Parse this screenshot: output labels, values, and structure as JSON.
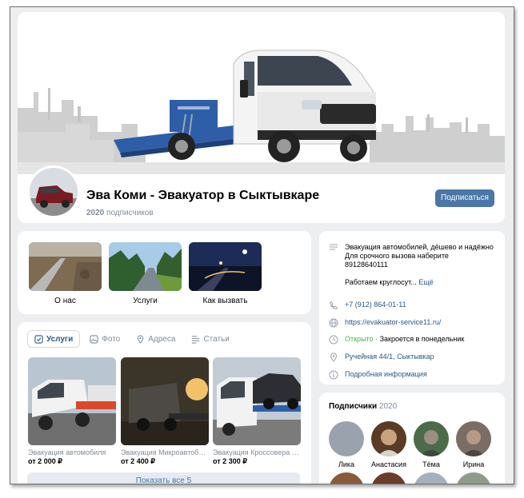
{
  "community": {
    "title": "Эва Коми - Эвакуатор в Сыктывкаре",
    "subscribers_count": "2020",
    "subscribers_word": "подписчиков",
    "subscribe_label": "Подписаться"
  },
  "links": [
    {
      "label": "О нас"
    },
    {
      "label": "Услуги"
    },
    {
      "label": "Как вызвать"
    }
  ],
  "goods": {
    "tabs": [
      {
        "label": "Услуги",
        "icon": "checkbox-icon"
      },
      {
        "label": "Фото",
        "icon": "photo-icon"
      },
      {
        "label": "Адреса",
        "icon": "location-icon"
      },
      {
        "label": "Статьи",
        "icon": "article-icon"
      }
    ],
    "items": [
      {
        "name": "Эвакуация автомобиля",
        "price": "от 2 000 ₽"
      },
      {
        "name": "Эвакуация Микроавтобуса",
        "price": "от 2 400 ₽"
      },
      {
        "name": "Эвакуация Кроссовера и внедорожника",
        "price": "от 2 300 ₽"
      }
    ],
    "show_all": "Показать все 5"
  },
  "info": {
    "description_line1": "Эвакуация автомобилей, дёшево и надёжно",
    "description_line2": "Для срочного вызова наберите",
    "description_line3": "89128640111",
    "description_line4": "Работаем круглосут...",
    "more": "Ещё",
    "phone": "+7 (912) 864-01-11",
    "website": "https://evakuator-service11.ru/",
    "status_open": "Открыто",
    "status_sep": "·",
    "status_close": "Закроется в понедельник",
    "address": "Ручейная 44/1, Сыктывкар",
    "details": "Подробная информация"
  },
  "subscribers": {
    "title": "Подписчики",
    "count": "2020",
    "members": [
      {
        "name": "Лика"
      },
      {
        "name": "Анастасия"
      },
      {
        "name": "Тёма"
      },
      {
        "name": "Ирина"
      }
    ]
  },
  "colors": {
    "accent": "#4a76a8",
    "link": "#2a5885",
    "secondary_text": "#818c99",
    "open_status": "#4bb34b",
    "page_bg": "#edeef0"
  }
}
